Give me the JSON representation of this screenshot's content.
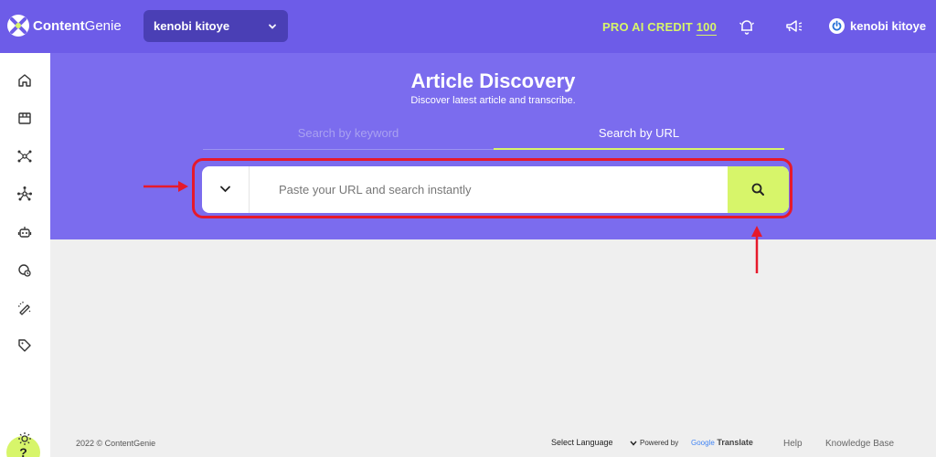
{
  "app": {
    "brand_bold": "Content",
    "brand_light": "Genie"
  },
  "header": {
    "workspace": "kenobi kitoye",
    "credit_label": "PRO AI CREDIT",
    "credit_value": "100",
    "user_name": "kenobi kitoye"
  },
  "sidebar": {
    "items": [
      {
        "icon": "home-icon"
      },
      {
        "icon": "store-icon"
      },
      {
        "icon": "network-icon"
      },
      {
        "icon": "network-alt-icon"
      },
      {
        "icon": "robot-icon"
      },
      {
        "icon": "search-doc-icon"
      },
      {
        "icon": "magic-pen-icon"
      },
      {
        "icon": "tag-icon"
      }
    ],
    "help_label": "?",
    "theme_icon": "sun-icon"
  },
  "hero": {
    "title": "Article Discovery",
    "subtitle": "Discover latest article and transcribe.",
    "tabs": [
      {
        "label": "Search by keyword",
        "active": false
      },
      {
        "label": "Search by URL",
        "active": true
      }
    ],
    "search_placeholder": "Paste your URL and search instantly"
  },
  "footer": {
    "copyright": "2022 © ContentGenie",
    "select_language": "Select Language",
    "powered_by": "Powered by",
    "google": "Google",
    "translate": "Translate",
    "help": "Help",
    "knowledge_base": "Knowledge Base"
  },
  "colors": {
    "topbar": "#6d5ce8",
    "hero": "#7b6cee",
    "accent": "#d7f56a",
    "annotation": "#e6192b"
  }
}
